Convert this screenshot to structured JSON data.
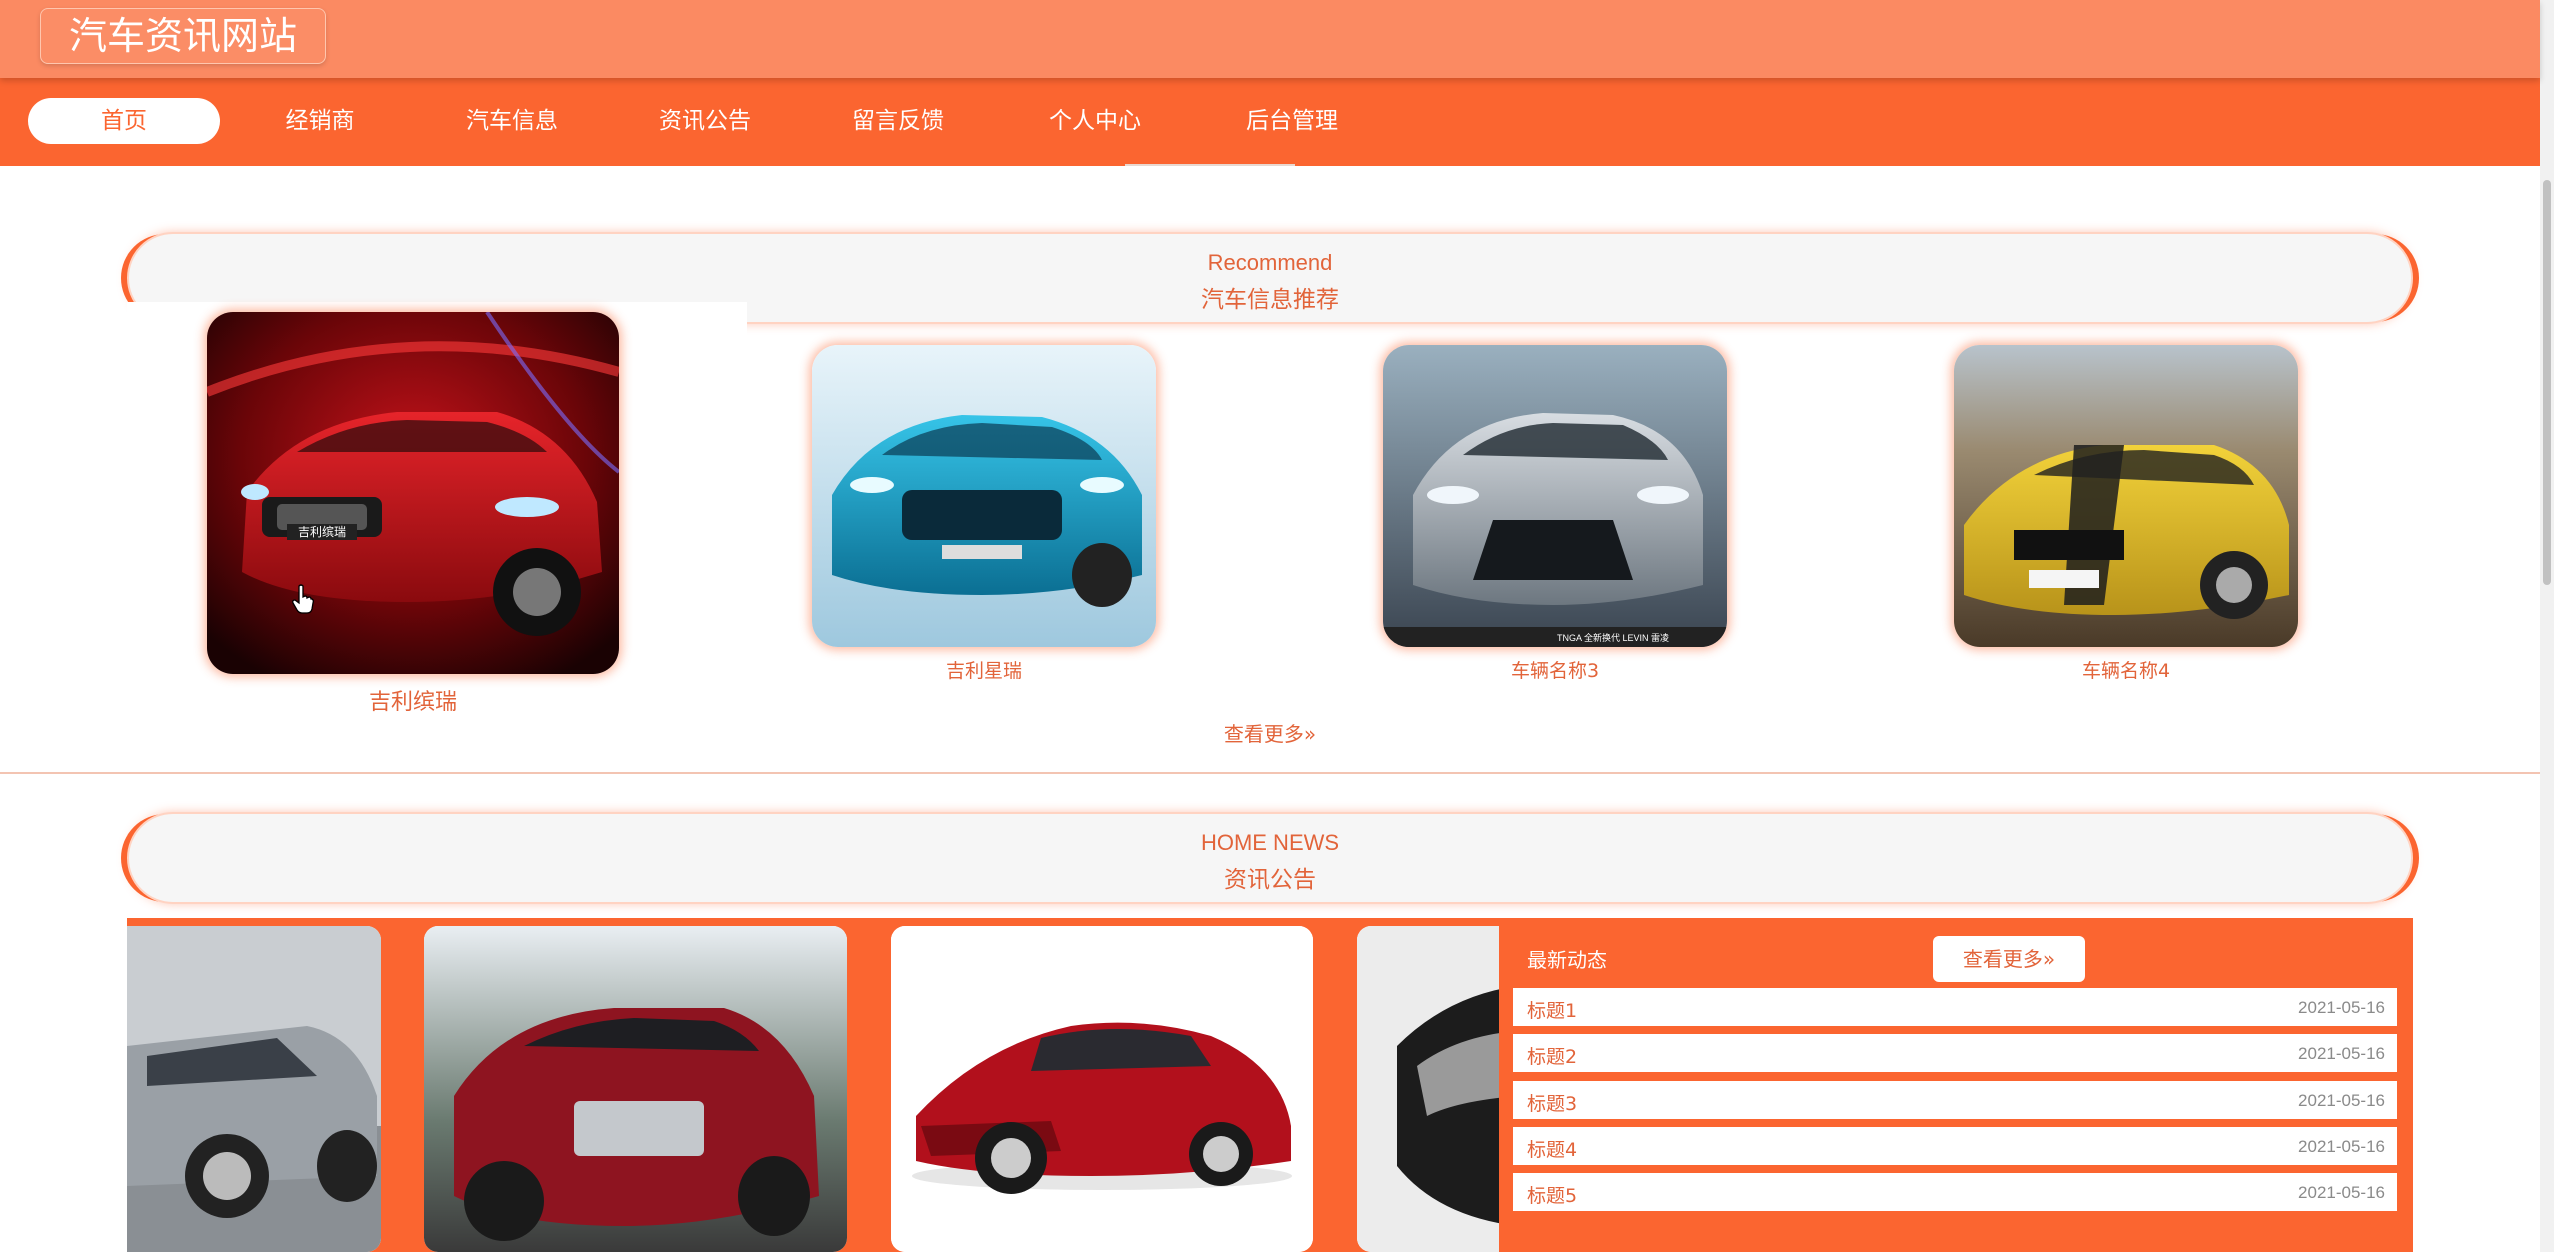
{
  "header": {
    "site_title": "汽车资讯网站"
  },
  "nav": {
    "items": [
      {
        "label": "首页",
        "active": true
      },
      {
        "label": "经销商"
      },
      {
        "label": "汽车信息"
      },
      {
        "label": "资讯公告"
      },
      {
        "label": "留言反馈"
      },
      {
        "label": "个人中心"
      },
      {
        "label": "后台管理"
      }
    ]
  },
  "recommend": {
    "title_en": "Recommend",
    "title_cn": "汽车信息推荐",
    "cards": [
      {
        "name": "吉利缤瑞"
      },
      {
        "name": "吉利星瑞"
      },
      {
        "name": "车辆名称3"
      },
      {
        "name": "车辆名称4"
      }
    ],
    "more_label": "查看更多»"
  },
  "news": {
    "title_en": "HOME NEWS",
    "title_cn": "资讯公告",
    "panel_title": "最新动态",
    "more_label": "查看更多»",
    "items": [
      {
        "title": "标题1",
        "date": "2021-05-16"
      },
      {
        "title": "标题2",
        "date": "2021-05-16"
      },
      {
        "title": "标题3",
        "date": "2021-05-16"
      },
      {
        "title": "标题4",
        "date": "2021-05-16"
      },
      {
        "title": "标题5",
        "date": "2021-05-16"
      }
    ]
  },
  "colors": {
    "primary": "#fb6530",
    "header": "#fb8a62",
    "text_accent": "#e2643a"
  }
}
